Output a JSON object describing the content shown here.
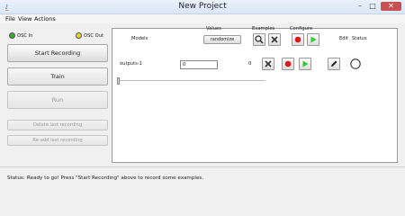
{
  "window": {
    "title": "New Project"
  },
  "menu": [
    "File",
    "View",
    "Actions"
  ],
  "osc": {
    "in_label": "OSC In",
    "out_label": "OSC Out",
    "in_color": "#2db12d",
    "out_color": "#e6d41a"
  },
  "sidebar": {
    "start_recording": "Start Recording",
    "train": "Train",
    "run": "Run",
    "delete_last": "Delete last recording",
    "readd_last": "Re-add last recording"
  },
  "table": {
    "headers": {
      "models": "Models",
      "values": "Values",
      "examples": "Examples",
      "configure": "Configure",
      "edit": "Edit",
      "status": "Status"
    },
    "randomize_label": "randomize",
    "rows": [
      {
        "name": "outputs-1",
        "value": "0",
        "examples": "0"
      }
    ]
  },
  "status": {
    "label": "Status:",
    "message": "Ready to go! Press \"Start Recording\" above to record some examples."
  },
  "colors": {
    "record": "#e01818",
    "run": "#2ecc2e"
  }
}
